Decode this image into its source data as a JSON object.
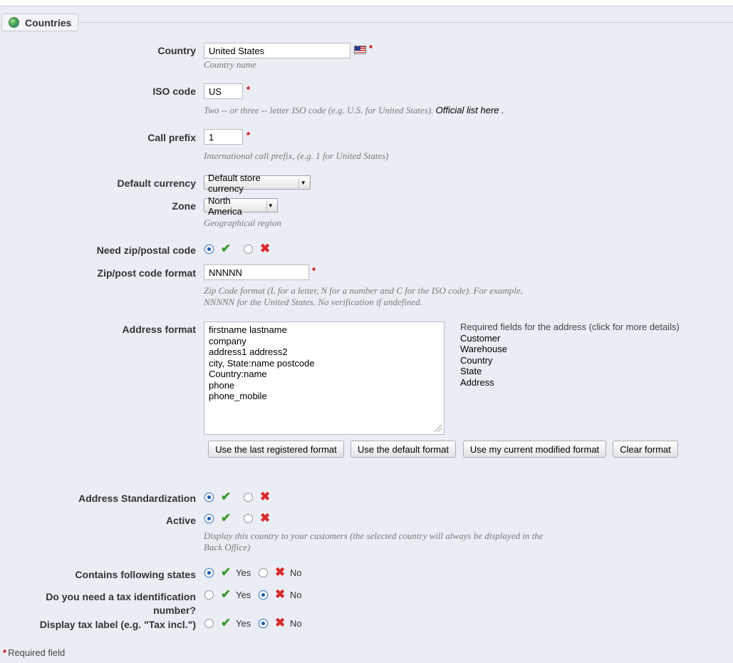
{
  "section": {
    "title": "Countries",
    "icon": "globe-icon"
  },
  "fields": {
    "country": {
      "label": "Country",
      "value": "United States",
      "hint": "Country name",
      "flag_icon": "us-flag-icon"
    },
    "iso_code": {
      "label": "ISO code",
      "value": "US",
      "hint": "Two -- or three -- letter ISO code (e.g. U.S. for United States).",
      "link": "Official list here",
      "link_after": " ."
    },
    "call_prefix": {
      "label": "Call prefix",
      "value": "1",
      "hint": "International call prefix, (e.g. 1 for United States)"
    },
    "default_currency": {
      "label": "Default currency",
      "value": "Default store currency"
    },
    "zone": {
      "label": "Zone",
      "value": "North America",
      "hint": "Geographical region"
    },
    "need_zip": {
      "label": "Need zip/postal code",
      "selected": "yes"
    },
    "zip_format": {
      "label": "Zip/post code format",
      "value": "NNNNN",
      "hint_line1": "Zip Code format (L for a letter, N for a number and C for the ISO code). For example,",
      "hint_line2": "NNNNN for the United States. No verification if undefined."
    },
    "address_format": {
      "label": "Address format",
      "lines": [
        "firstname lastname",
        "company",
        "address1 address2",
        "city, State:name postcode",
        "Country:name",
        "phone",
        "phone_mobile"
      ],
      "required_title": "Required fields for the address (click for more details)",
      "required_items": [
        "Customer",
        "Warehouse",
        "Country",
        "State",
        "Address"
      ],
      "buttons": [
        "Use the last registered format",
        "Use the default format",
        "Use my current modified format",
        "Clear format"
      ]
    },
    "address_std": {
      "label": "Address Standardization",
      "selected": "yes"
    },
    "active": {
      "label": "Active",
      "selected": "yes",
      "hint_line1": "Display this country to your customers (the selected country will always be displayed in the",
      "hint_line2": "Back Office)"
    },
    "contains_states": {
      "label": "Contains following states",
      "selected": "yes",
      "yes": "Yes",
      "no": "No"
    },
    "tax_id": {
      "label": "Do you need a tax identification number?",
      "selected": "no",
      "yes": "Yes",
      "no": "No"
    },
    "tax_label": {
      "label": "Display tax label (e.g. \"Tax incl.\")",
      "selected": "no",
      "yes": "Yes",
      "no": "No"
    }
  },
  "required_marker": "*",
  "footnote": "Required field",
  "colors": {
    "background": "#ebedf4",
    "required": "#cc0000",
    "check": "#3c9a2f",
    "cross": "#d92b2b"
  }
}
